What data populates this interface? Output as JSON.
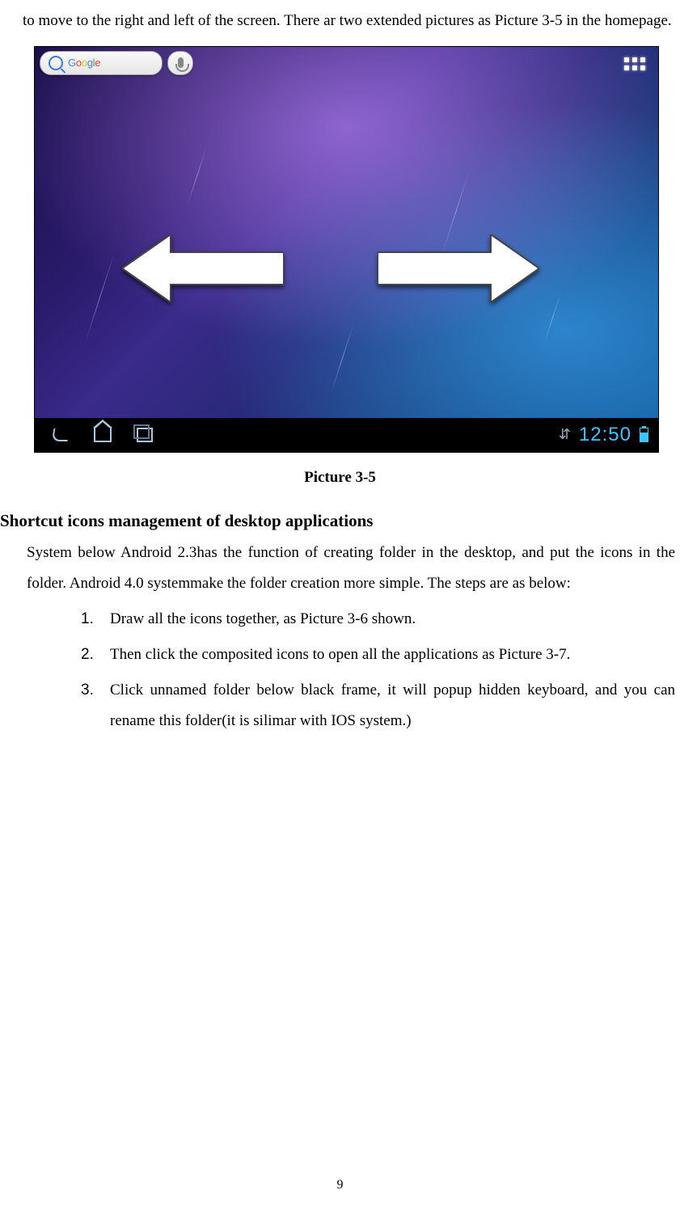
{
  "intro_text": "to move to the right and left of the screen. There ar two extended pictures as Picture 3-5 in the homepage.",
  "figure": {
    "search_brand": "Google",
    "clock": "12:50",
    "caption": "Picture 3-5"
  },
  "section": {
    "heading": "Shortcut icons management of desktop applications",
    "paragraph": "System below Android 2.3has the function of creating folder in the desktop, and put the icons in the folder. Android 4.0 systemmake the folder creation more simple. The steps are as below:",
    "steps": [
      "Draw all the icons together, as Picture 3-6 shown.",
      "Then click the composited icons to open all the applications as Picture 3-7.",
      "Click unnamed folder below black frame, it will popup hidden keyboard, and you can rename this folder(it is silimar with IOS system.)"
    ]
  },
  "page_number": "9"
}
